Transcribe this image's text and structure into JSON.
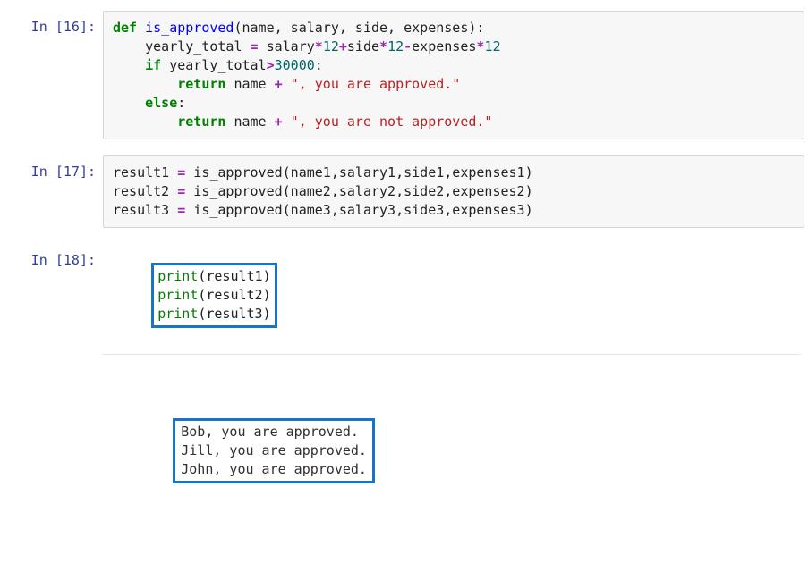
{
  "cells": [
    {
      "prompt_label": "In ",
      "prompt_num": "16",
      "code": {
        "def": "def",
        "fname": "is_approved",
        "params": "(name, salary, side, expenses):",
        "l2a": "    yearly_total ",
        "l2b": " salary",
        "l2op1": "*",
        "l2n1": "12",
        "l2op2": "+",
        "l2c": "side",
        "l2op3": "*",
        "l2n2": "12",
        "l2op4": "-",
        "l2d": "expenses",
        "l2op5": "*",
        "l2n3": "12",
        "l3a": "    ",
        "l3if": "if",
        "l3b": " yearly_total",
        "l3op": ">",
        "l3n": "30000",
        "l3c": ":",
        "l4a": "        ",
        "l4ret": "return",
        "l4b": " name ",
        "l4op": "+",
        "l4s": " \", you are approved.\"",
        "l5a": "    ",
        "l5else": "else",
        "l5b": ":",
        "l6a": "        ",
        "l6ret": "return",
        "l6b": " name ",
        "l6op": "+",
        "l6s": " \", you are not approved.\""
      }
    },
    {
      "prompt_label": "In ",
      "prompt_num": "17",
      "code": {
        "l1": "result1 ",
        "l1eq": "=",
        "l1b": " is_approved(name1,salary1,side1,expenses1)",
        "l2": "result2 ",
        "l2eq": "=",
        "l2b": " is_approved(name2,salary2,side2,expenses2)",
        "l3": "result3 ",
        "l3eq": "=",
        "l3b": " is_approved(name3,salary3,side3,expenses3)"
      }
    },
    {
      "prompt_label": "In ",
      "prompt_num": "18",
      "code": {
        "p": "print",
        "a1": "(result1)",
        "a2": "(result2)",
        "a3": "(result3)"
      },
      "output": {
        "l1": "Bob, you are approved.",
        "l2": "Jill, you are approved.",
        "l3": "John, you are approved."
      }
    }
  ]
}
